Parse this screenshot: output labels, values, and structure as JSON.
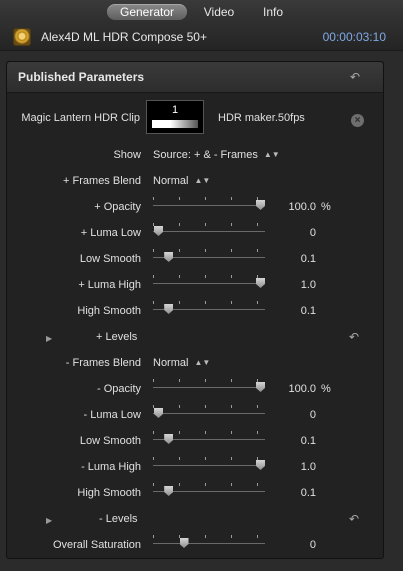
{
  "tabs": [
    {
      "label": "Generator",
      "active": true
    },
    {
      "label": "Video",
      "active": false
    },
    {
      "label": "Info",
      "active": false
    }
  ],
  "header": {
    "title": "Alex4D ML HDR Compose 50+",
    "timecode": "00:00:03:10",
    "icon": "generator-icon"
  },
  "panel": {
    "title": "Published Parameters",
    "clip": {
      "label": "Magic Lantern HDR Clip",
      "well_number": "1",
      "clip_name": "HDR maker.50fps"
    },
    "show": {
      "label": "Show",
      "value": "Source: + & - Frames"
    },
    "plus": {
      "frames_blend": {
        "label": "+ Frames Blend",
        "value": "Normal"
      },
      "opacity": {
        "label": "+ Opacity",
        "value": "100.0",
        "unit": "%",
        "fraction": 1.0
      },
      "luma_low": {
        "label": "+ Luma Low",
        "value": "0",
        "fraction": 0.0
      },
      "low_smooth": {
        "label": "Low Smooth",
        "value": "0.1",
        "fraction": 0.1
      },
      "luma_high": {
        "label": "+ Luma High",
        "value": "1.0",
        "fraction": 1.0
      },
      "high_smooth": {
        "label": "High Smooth",
        "value": "0.1",
        "fraction": 0.1
      },
      "levels": {
        "label": "+ Levels"
      }
    },
    "minus": {
      "frames_blend": {
        "label": "- Frames Blend",
        "value": "Normal"
      },
      "opacity": {
        "label": "- Opacity",
        "value": "100.0",
        "unit": "%",
        "fraction": 1.0
      },
      "luma_low": {
        "label": "- Luma Low",
        "value": "0",
        "fraction": 0.0
      },
      "low_smooth": {
        "label": "Low Smooth",
        "value": "0.1",
        "fraction": 0.1
      },
      "luma_high": {
        "label": "- Luma High",
        "value": "1.0",
        "fraction": 1.0
      },
      "high_smooth": {
        "label": "High Smooth",
        "value": "0.1",
        "fraction": 0.1
      },
      "levels": {
        "label": "- Levels"
      }
    },
    "overall_saturation": {
      "label": "Overall Saturation",
      "value": "0",
      "fraction": 0.25
    }
  },
  "colors": {
    "accent": "#7fa9e6"
  }
}
